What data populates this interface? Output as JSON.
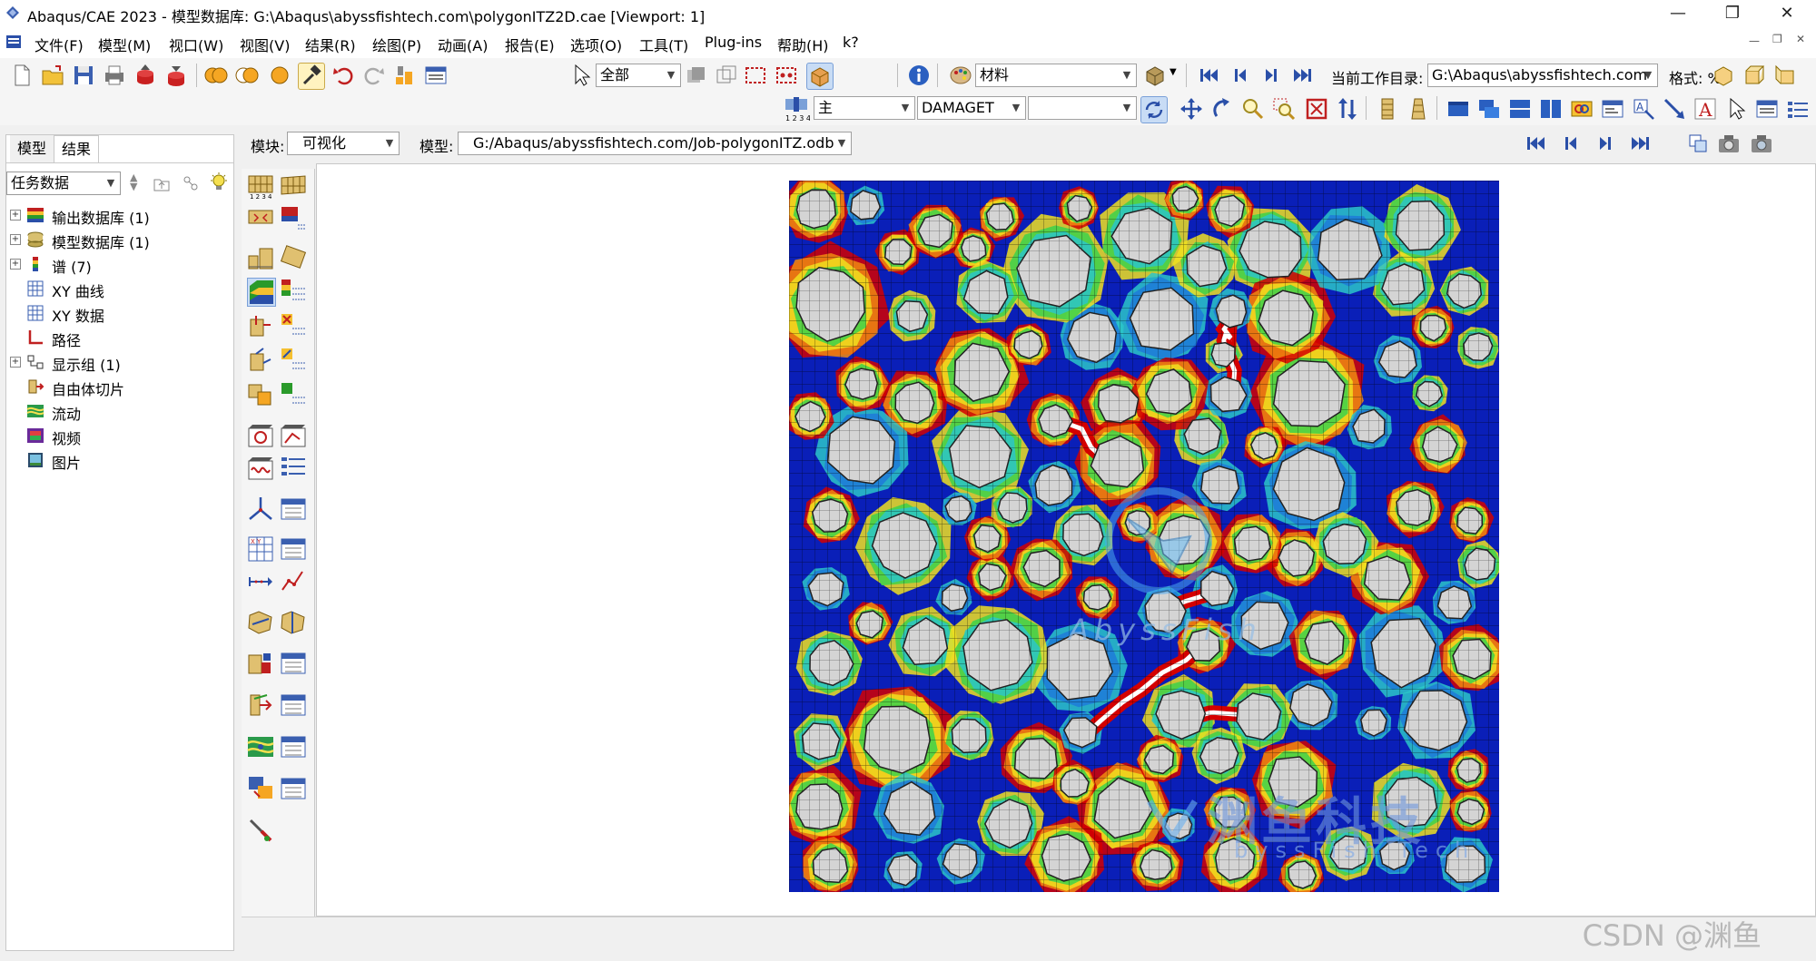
{
  "window": {
    "title": "Abaqus/CAE 2023 - 模型数据库: G:\\Abaqus\\abyssfishtech.com\\polygonITZ2D.cae [Viewport: 1]",
    "minimize": "—",
    "restore": "❐",
    "close": "✕"
  },
  "menubar": {
    "items": [
      "文件(F)",
      "模型(M)",
      "视口(W)",
      "视图(V)",
      "结果(R)",
      "绘图(P)",
      "动画(A)",
      "报告(E)",
      "选项(O)",
      "工具(T)",
      "Plug-ins",
      "帮助(H)",
      "k?"
    ]
  },
  "toolbar": {
    "selection_filter": "全部",
    "color_code": "材料",
    "workdir_label": "当前工作目录:",
    "workdir_value": "G:\\Abaqus\\abyssfishtech.com",
    "format_label": "格式: %s",
    "step_value": "主",
    "field_output": "DAMAGET",
    "field_component": ""
  },
  "context": {
    "module_label": "模块:",
    "module_value": "可视化",
    "model_label": "模型:",
    "model_value": "G:/Abaqus/abyssfishtech.com/Job-polygonITZ.odb"
  },
  "leftpanel": {
    "tabs": [
      "模型",
      "结果"
    ],
    "active_tab": "结果",
    "filter_value": "任务数据",
    "tree": [
      {
        "label": "输出数据库 (1)",
        "expandable": true
      },
      {
        "label": "模型数据库 (1)",
        "expandable": true
      },
      {
        "label": "谱 (7)",
        "expandable": true
      },
      {
        "label": "XY 曲线",
        "expandable": false
      },
      {
        "label": "XY 数据",
        "expandable": false
      },
      {
        "label": "路径",
        "expandable": false
      },
      {
        "label": "显示组 (1)",
        "expandable": true
      },
      {
        "label": "自由体切片",
        "expandable": false
      },
      {
        "label": "流动",
        "expandable": false
      },
      {
        "label": "视频",
        "expandable": false
      },
      {
        "label": "图片",
        "expandable": false
      }
    ]
  },
  "viewport": {
    "overlay_text": "AbyssFish",
    "logo_text_cn": "渊鱼科技",
    "logo_text_en": "byssFish Tech",
    "colors": {
      "background": "#ffffff",
      "field_low": "#0a1fb8",
      "field_high": "#d40000",
      "aggregate": "#d4d4d4",
      "crack": "#ffffff"
    }
  },
  "watermark": "CSDN @渊鱼"
}
